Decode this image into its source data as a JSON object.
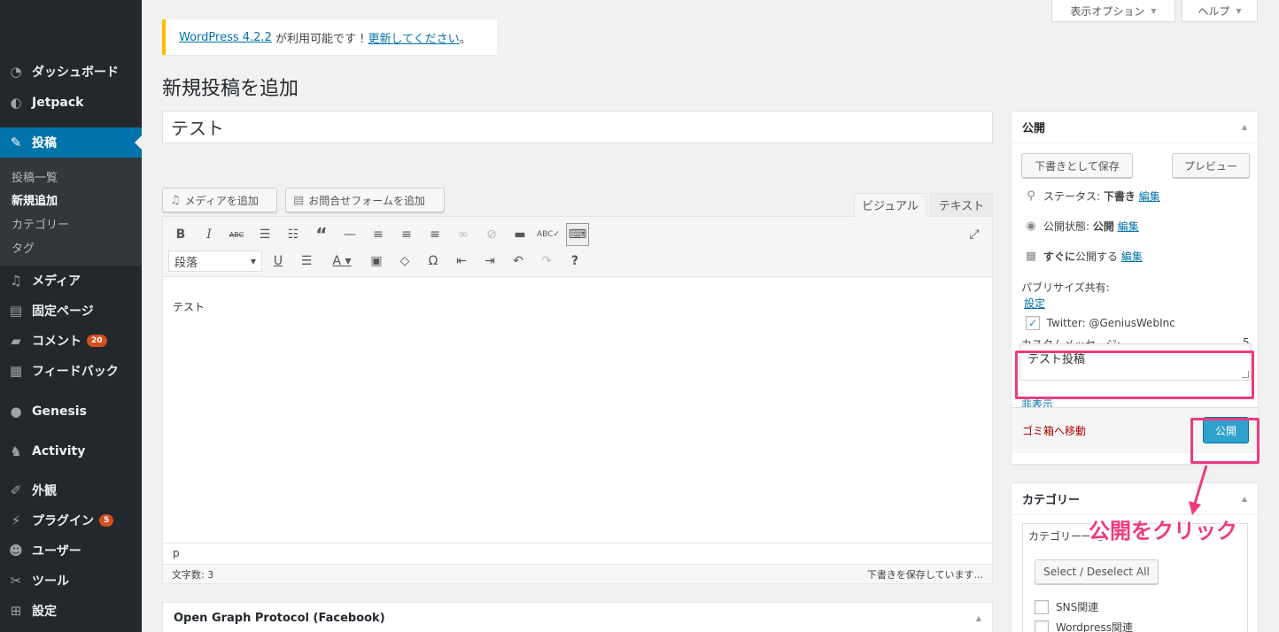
{
  "sidebar": {
    "items": [
      {
        "icon": "dashboard-icon",
        "label": "ダッシュボード"
      },
      {
        "icon": "jetpack-icon",
        "label": "Jetpack"
      },
      {
        "icon": "pin-icon",
        "label": "投稿"
      },
      {
        "icon": "media-icon",
        "label": "メディア"
      },
      {
        "icon": "page-icon",
        "label": "固定ページ"
      },
      {
        "icon": "comment-icon",
        "label": "コメント",
        "badge": "20"
      },
      {
        "icon": "feedback-icon",
        "label": "フィードバック"
      },
      {
        "icon": "genesis-icon",
        "label": "Genesis"
      },
      {
        "icon": "activity-icon",
        "label": "Activity"
      },
      {
        "icon": "appearance-icon",
        "label": "外観"
      },
      {
        "icon": "plugin-icon",
        "label": "プラグイン",
        "badge": "5"
      },
      {
        "icon": "users-icon",
        "label": "ユーザー"
      },
      {
        "icon": "tools-icon",
        "label": "ツール"
      },
      {
        "icon": "settings-icon",
        "label": "設定"
      }
    ],
    "submenu": [
      "投稿一覧",
      "新規追加",
      "カテゴリー",
      "タグ"
    ]
  },
  "top": {
    "screen_options": "表示オプション",
    "help": "ヘルプ"
  },
  "notice": {
    "version_link": "WordPress 4.2.2",
    "text": " が利用可能です ! ",
    "update_link": "更新してください",
    "end": "。"
  },
  "page_title": "新規投稿を追加",
  "post_title": "テスト",
  "media_buttons": {
    "add_media": "メディアを追加",
    "add_form": "お問合せフォームを追加"
  },
  "editor_tabs": {
    "visual": "ビジュアル",
    "text": "テキスト"
  },
  "editor": {
    "format": "段落",
    "content": "テスト",
    "path": "p",
    "word_count": "文字数: 3",
    "save_status": "下書きを保存しています..."
  },
  "publish_box": {
    "title": "公開",
    "save_draft": "下書きとして保存",
    "preview": "プレビュー",
    "status_label": "ステータス: ",
    "status_value": "下書き",
    "visibility_label": "公開状態: ",
    "visibility_value": "公開",
    "schedule_strong": "すぐに",
    "schedule_text": "公開する",
    "edit": "編集",
    "publicize_label": "パブリサイズ共有:",
    "settings_link": "設定",
    "twitter": "Twitter: @GeniusWebInc",
    "custom_msg_label": "カスタムメッセージ:",
    "custom_msg_count": "5",
    "custom_msg": "テスト投稿",
    "hide_link": "非表示",
    "trash": "ゴミ箱へ移動",
    "publish": "公開"
  },
  "category_box": {
    "title": "カテゴリー",
    "tab_label": "カテゴリー一覧",
    "select_all": "Select / Deselect All",
    "items": [
      "SNS関連",
      "Wordpress関連"
    ]
  },
  "og_box": {
    "title": "Open Graph Protocol (Facebook)"
  },
  "annotation": "公開をクリック",
  "colors": {
    "highlight": "#ee3b7f",
    "primary": "#0073aa",
    "sidebar": "#23282d"
  }
}
